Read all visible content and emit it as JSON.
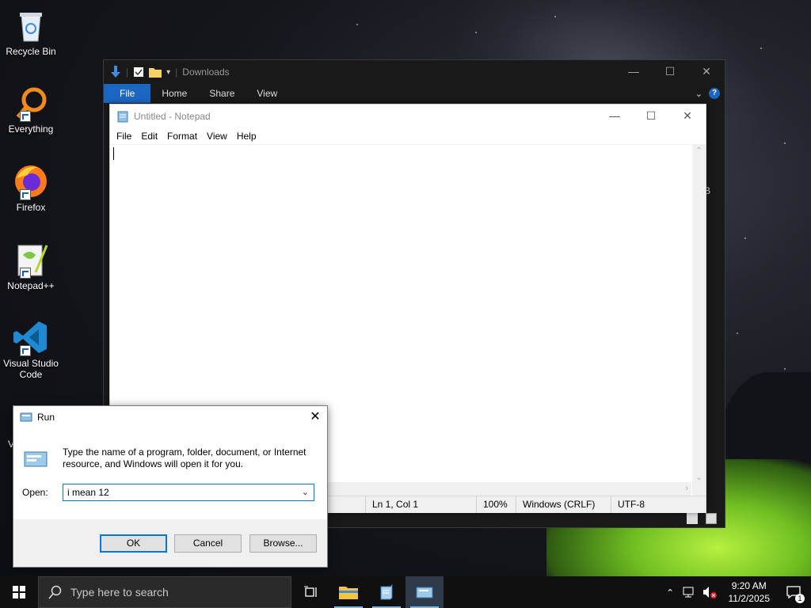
{
  "desktop": {
    "icons": [
      {
        "label": "Recycle Bin"
      },
      {
        "label": "Everything"
      },
      {
        "label": "Firefox"
      },
      {
        "label": "Notepad++"
      },
      {
        "label": "Visual Studio Code"
      }
    ],
    "partial_label": "V"
  },
  "explorer": {
    "title": "Downloads",
    "tabs": [
      "File",
      "Home",
      "Share",
      "View"
    ],
    "edge_fragment": "B",
    "accent": "#1a66c2"
  },
  "notepad": {
    "title": "Untitled - Notepad",
    "menu": [
      "File",
      "Edit",
      "Format",
      "View",
      "Help"
    ],
    "status": {
      "position": "Ln 1, Col 1",
      "zoom": "100%",
      "line_ending": "Windows (CRLF)",
      "encoding": "UTF-8"
    }
  },
  "run": {
    "title": "Run",
    "description": "Type the name of a program, folder, document, or Internet resource, and Windows will open it for you.",
    "open_label": "Open:",
    "input_value": "i mean 12",
    "ok": "OK",
    "cancel": "Cancel",
    "browse": "Browse..."
  },
  "taskbar": {
    "search_placeholder": "Type here to search",
    "time": "9:20 AM",
    "date": "11/2/2025",
    "notification_count": "1"
  }
}
